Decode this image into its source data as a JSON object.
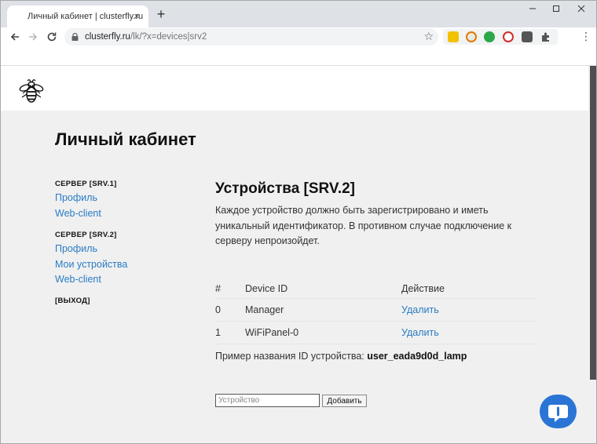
{
  "browser": {
    "tab_title": "Личный кабинет | clusterfly.ru",
    "tab_close": "×",
    "new_tab": "+",
    "url_host": "clusterfly.ru",
    "url_path": "/lk/?x=devices|srv2"
  },
  "page": {
    "title": "Личный кабинет"
  },
  "sidebar": {
    "server1_heading": "СЕРВЕР [SRV.1]",
    "server1_links": [
      "Профиль",
      "Web-client"
    ],
    "server2_heading": "СЕРВЕР [SRV.2]",
    "server2_links": [
      "Профиль",
      "Мои устройства",
      "Web-client"
    ],
    "logout": "[ВЫХОД]"
  },
  "main": {
    "title": "Устройства [SRV.2]",
    "description": "Каждое устройство должно быть зарегистрировано и иметь уникальный идентификатор. В противном случае подключение к серверу непроизойдет.",
    "table": {
      "headers": [
        "#",
        "Device ID",
        "Действие"
      ],
      "rows": [
        {
          "num": "0",
          "device_id": "Manager",
          "action": "Удалить"
        },
        {
          "num": "1",
          "device_id": "WiFiPanel-0",
          "action": "Удалить"
        }
      ]
    },
    "example_label": "Пример названия ID устройства:",
    "example_value": "user_eada9d0d_lamp",
    "input_placeholder": "Устройство",
    "add_button": "Добавить"
  },
  "colors": {
    "link": "#2a7bc4",
    "chat_button": "#2a74d6",
    "page_background": "#f0f0f0"
  },
  "icons": {
    "logo": "bee-logo-icon",
    "chat": "chat-bubble-icon"
  }
}
